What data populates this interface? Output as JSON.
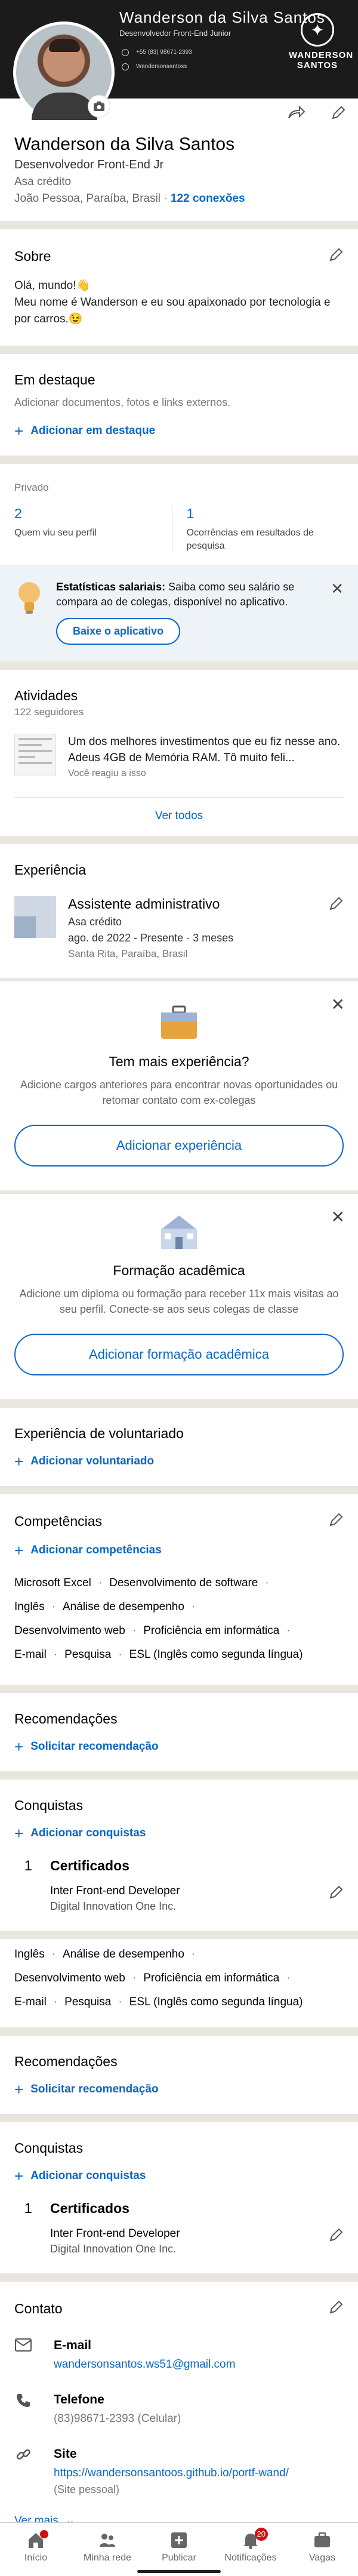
{
  "header": {
    "cover_name": "Wanderson da Silva Santos",
    "cover_role": "Desenvolvedor Front-End Junior",
    "cover_phone": "+55 (83) 98671-2393",
    "cover_handle": "Wandersonsantoss",
    "cover_logo": "WANDERSON SANTOS",
    "name": "Wanderson da Silva Santos",
    "headline": "Desenvolvedor Front-End Jr",
    "company": "Asa crédito",
    "location": "João Pessoa, Paraíba, Brasil",
    "connections": "122 conexões"
  },
  "about": {
    "title": "Sobre",
    "line1": "Olá, mundo!👋",
    "line2": "Meu nome é Wanderson e eu sou apaixonado por tecnologia e por carros.😉"
  },
  "featured": {
    "title": "Em destaque",
    "desc": "Adicionar documentos, fotos e links externos.",
    "add": "Adicionar em destaque"
  },
  "private": {
    "label": "Privado",
    "stat1_n": "2",
    "stat1_l": "Quem viu seu perfil",
    "stat2_n": "1",
    "stat2_l": "Ocorrências em resultados de pesquisa",
    "salary_bold": "Estatísticas salariais:",
    "salary_text": " Saiba como seu salário se compara ao de colegas, disponível no aplicativo.",
    "salary_btn": "Baixe o aplicativo"
  },
  "activity": {
    "title": "Atividades",
    "followers": "122 seguidores",
    "post_text": "Um dos melhores investimentos que eu fiz nesse ano. Adeus 4GB de Memória RAM. Tô muito feli...",
    "post_sub": "Você reagiu a isso",
    "see_all": "Ver todos"
  },
  "experience": {
    "title": "Experiência",
    "job_title": "Assistente administrativo",
    "job_company": "Asa crédito",
    "job_dates": "ago. de 2022 - Presente · 3 meses",
    "job_location": "Santa Rita, Paraíba, Brasil",
    "promo_title": "Tem mais experiência?",
    "promo_text": "Adicione cargos anteriores para encontrar novas oportunidades ou retomar contato com ex-colegas",
    "promo_btn": "Adicionar experiência"
  },
  "education": {
    "title": "Formação acadêmica",
    "text": "Adicione um diploma ou formação para receber 11x mais visitas ao seu perfil. Conecte-se aos seus colegas de classe",
    "btn": "Adicionar formação acadêmica"
  },
  "volunteer": {
    "title": "Experiência de voluntariado",
    "add": "Adicionar voluntariado"
  },
  "skills": {
    "title": "Competências",
    "add": "Adicionar competências",
    "rows": [
      [
        "Microsoft Excel",
        "Desenvolvimento de software"
      ],
      [
        "Inglês",
        "Análise de desempenho"
      ],
      [
        "Desenvolvimento web",
        "Proficiência em informática"
      ],
      [
        "E-mail",
        "Pesquisa",
        "ESL (Inglês como segunda língua)"
      ]
    ]
  },
  "recommendations": {
    "title": "Recomendações",
    "add": "Solicitar recomendação"
  },
  "achievements": {
    "title": "Conquistas",
    "add": "Adicionar conquistas",
    "count": "1",
    "category": "Certificados",
    "item_title": "Inter Front-end Developer",
    "item_org": "Digital Innovation One Inc."
  },
  "skills_repeat": {
    "rows": [
      [
        "Inglês",
        "Análise de desempenho"
      ],
      [
        "Desenvolvimento web",
        "Proficiência em informática"
      ],
      [
        "E-mail",
        "Pesquisa",
        "ESL (Inglês como segunda língua)"
      ]
    ]
  },
  "recommendations2": {
    "title": "Recomendações",
    "add": "Solicitar recomendação"
  },
  "achievements2": {
    "title": "Conquistas",
    "add": "Adicionar conquistas",
    "count": "1",
    "category": "Certificados",
    "item_title": "Inter Front-end Developer",
    "item_org": "Digital Innovation One Inc."
  },
  "contact": {
    "title": "Contato",
    "email_k": "E-mail",
    "email_v": "wandersonsantos.ws51@gmail.com",
    "phone_k": "Telefone",
    "phone_v": "(83)98671-2393 (Celular)",
    "site_k": "Site",
    "site_v": "https://wandersonsantoos.github.io/portf-wand/",
    "site_sub": "(Site pessoal)",
    "more": "Ver mais"
  },
  "nav": {
    "home": "Início",
    "network": "Minha rede",
    "post": "Publicar",
    "notifications": "Notificações",
    "notif_count": "20",
    "jobs": "Vagas"
  },
  "colors": {
    "accent": "#0a66c2",
    "badge": "#cc1016",
    "cover": "#1b1b1b"
  }
}
